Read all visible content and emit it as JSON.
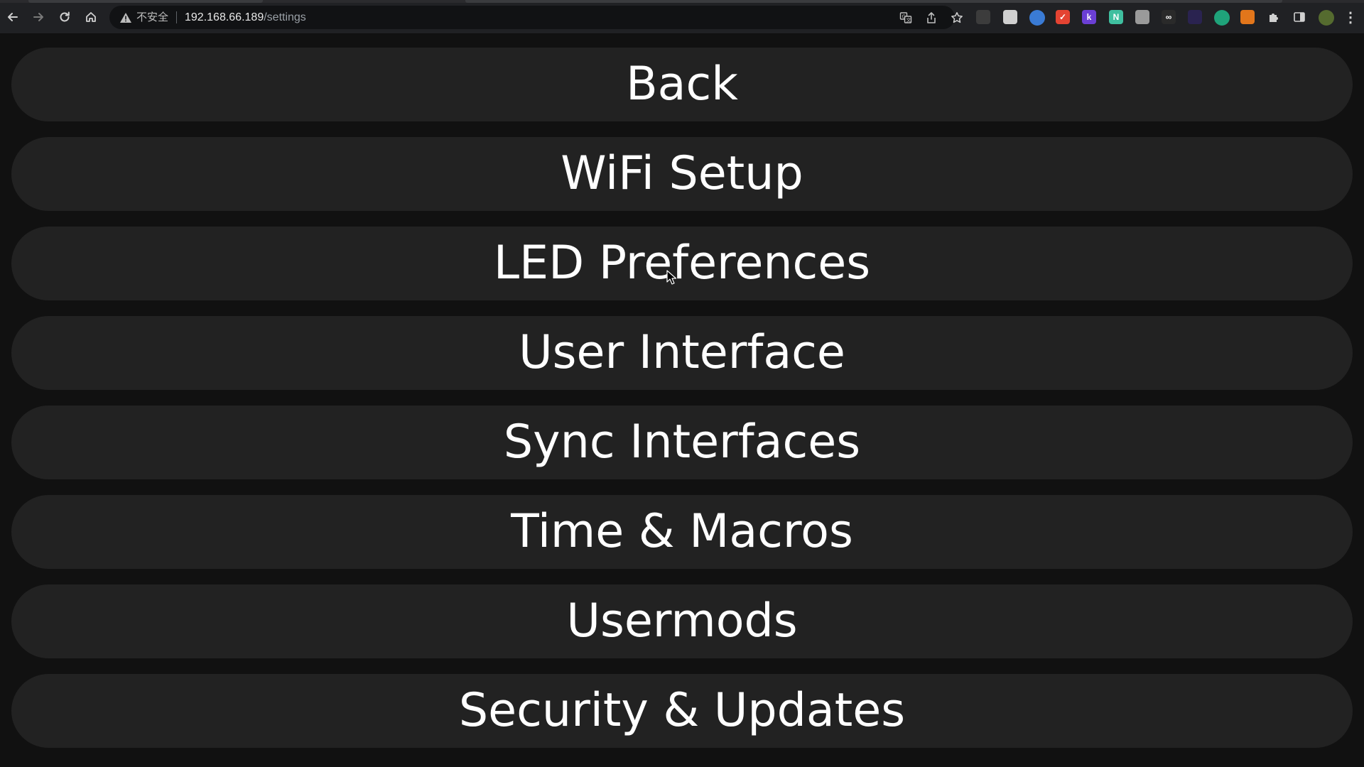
{
  "browser": {
    "url_insecure_label": "不安全",
    "url_host": "192.168.66.189",
    "url_path": "/settings",
    "icons": {
      "back": "back-arrow-icon",
      "forward": "forward-arrow-icon",
      "reload": "reload-icon",
      "home": "home-icon",
      "warning": "not-secure-warning-icon",
      "translate": "translate-icon",
      "share": "share-icon",
      "bookmark": "star-icon"
    },
    "extensions": [
      {
        "name": "chatgpt-extension-icon",
        "glyph": "",
        "color": "#3c3c3c"
      },
      {
        "name": "chat-bubble-extension-icon",
        "glyph": "",
        "color": "#d0d0d0"
      },
      {
        "name": "circle-extension-icon",
        "glyph": "",
        "color": "#3a7bd5"
      },
      {
        "name": "todo-check-extension-icon",
        "glyph": "✓",
        "color": "#e44332"
      },
      {
        "name": "k-extension-icon",
        "glyph": "k",
        "color": "#6b3fd4"
      },
      {
        "name": "notion-n-extension-icon",
        "glyph": "N",
        "color": "#3fbf9f"
      },
      {
        "name": "square-extension-icon",
        "glyph": "",
        "color": "#9a9a9a"
      },
      {
        "name": "glasses-extension-icon",
        "glyph": "∞",
        "color": "#2a2a2a"
      },
      {
        "name": "red-badge-extension-icon",
        "glyph": "",
        "color": "#2a2350"
      },
      {
        "name": "green-globe-extension-icon",
        "glyph": "",
        "color": "#1fa37a"
      },
      {
        "name": "metamask-fox-extension-icon",
        "glyph": "",
        "color": "#e2761b"
      },
      {
        "name": "puzzle-extensions-icon",
        "glyph": "",
        "color": "transparent"
      },
      {
        "name": "side-panel-icon",
        "glyph": "",
        "color": "transparent"
      },
      {
        "name": "profile-avatar-icon",
        "glyph": "",
        "color": "#556b2f"
      },
      {
        "name": "more-menu-icon",
        "glyph": "⋮",
        "color": "transparent"
      }
    ]
  },
  "menu": {
    "items": [
      {
        "label": "Back",
        "name": "back-button"
      },
      {
        "label": "WiFi Setup",
        "name": "wifi-setup-button"
      },
      {
        "label": "LED Preferences",
        "name": "led-preferences-button"
      },
      {
        "label": "User Interface",
        "name": "user-interface-button"
      },
      {
        "label": "Sync Interfaces",
        "name": "sync-interfaces-button"
      },
      {
        "label": "Time & Macros",
        "name": "time-macros-button"
      },
      {
        "label": "Usermods",
        "name": "usermods-button"
      },
      {
        "label": "Security & Updates",
        "name": "security-updates-button"
      }
    ]
  },
  "colors": {
    "page_background": "#111111",
    "button_background": "#222222",
    "button_text": "#ffffff",
    "toolbar_background": "#202124"
  }
}
